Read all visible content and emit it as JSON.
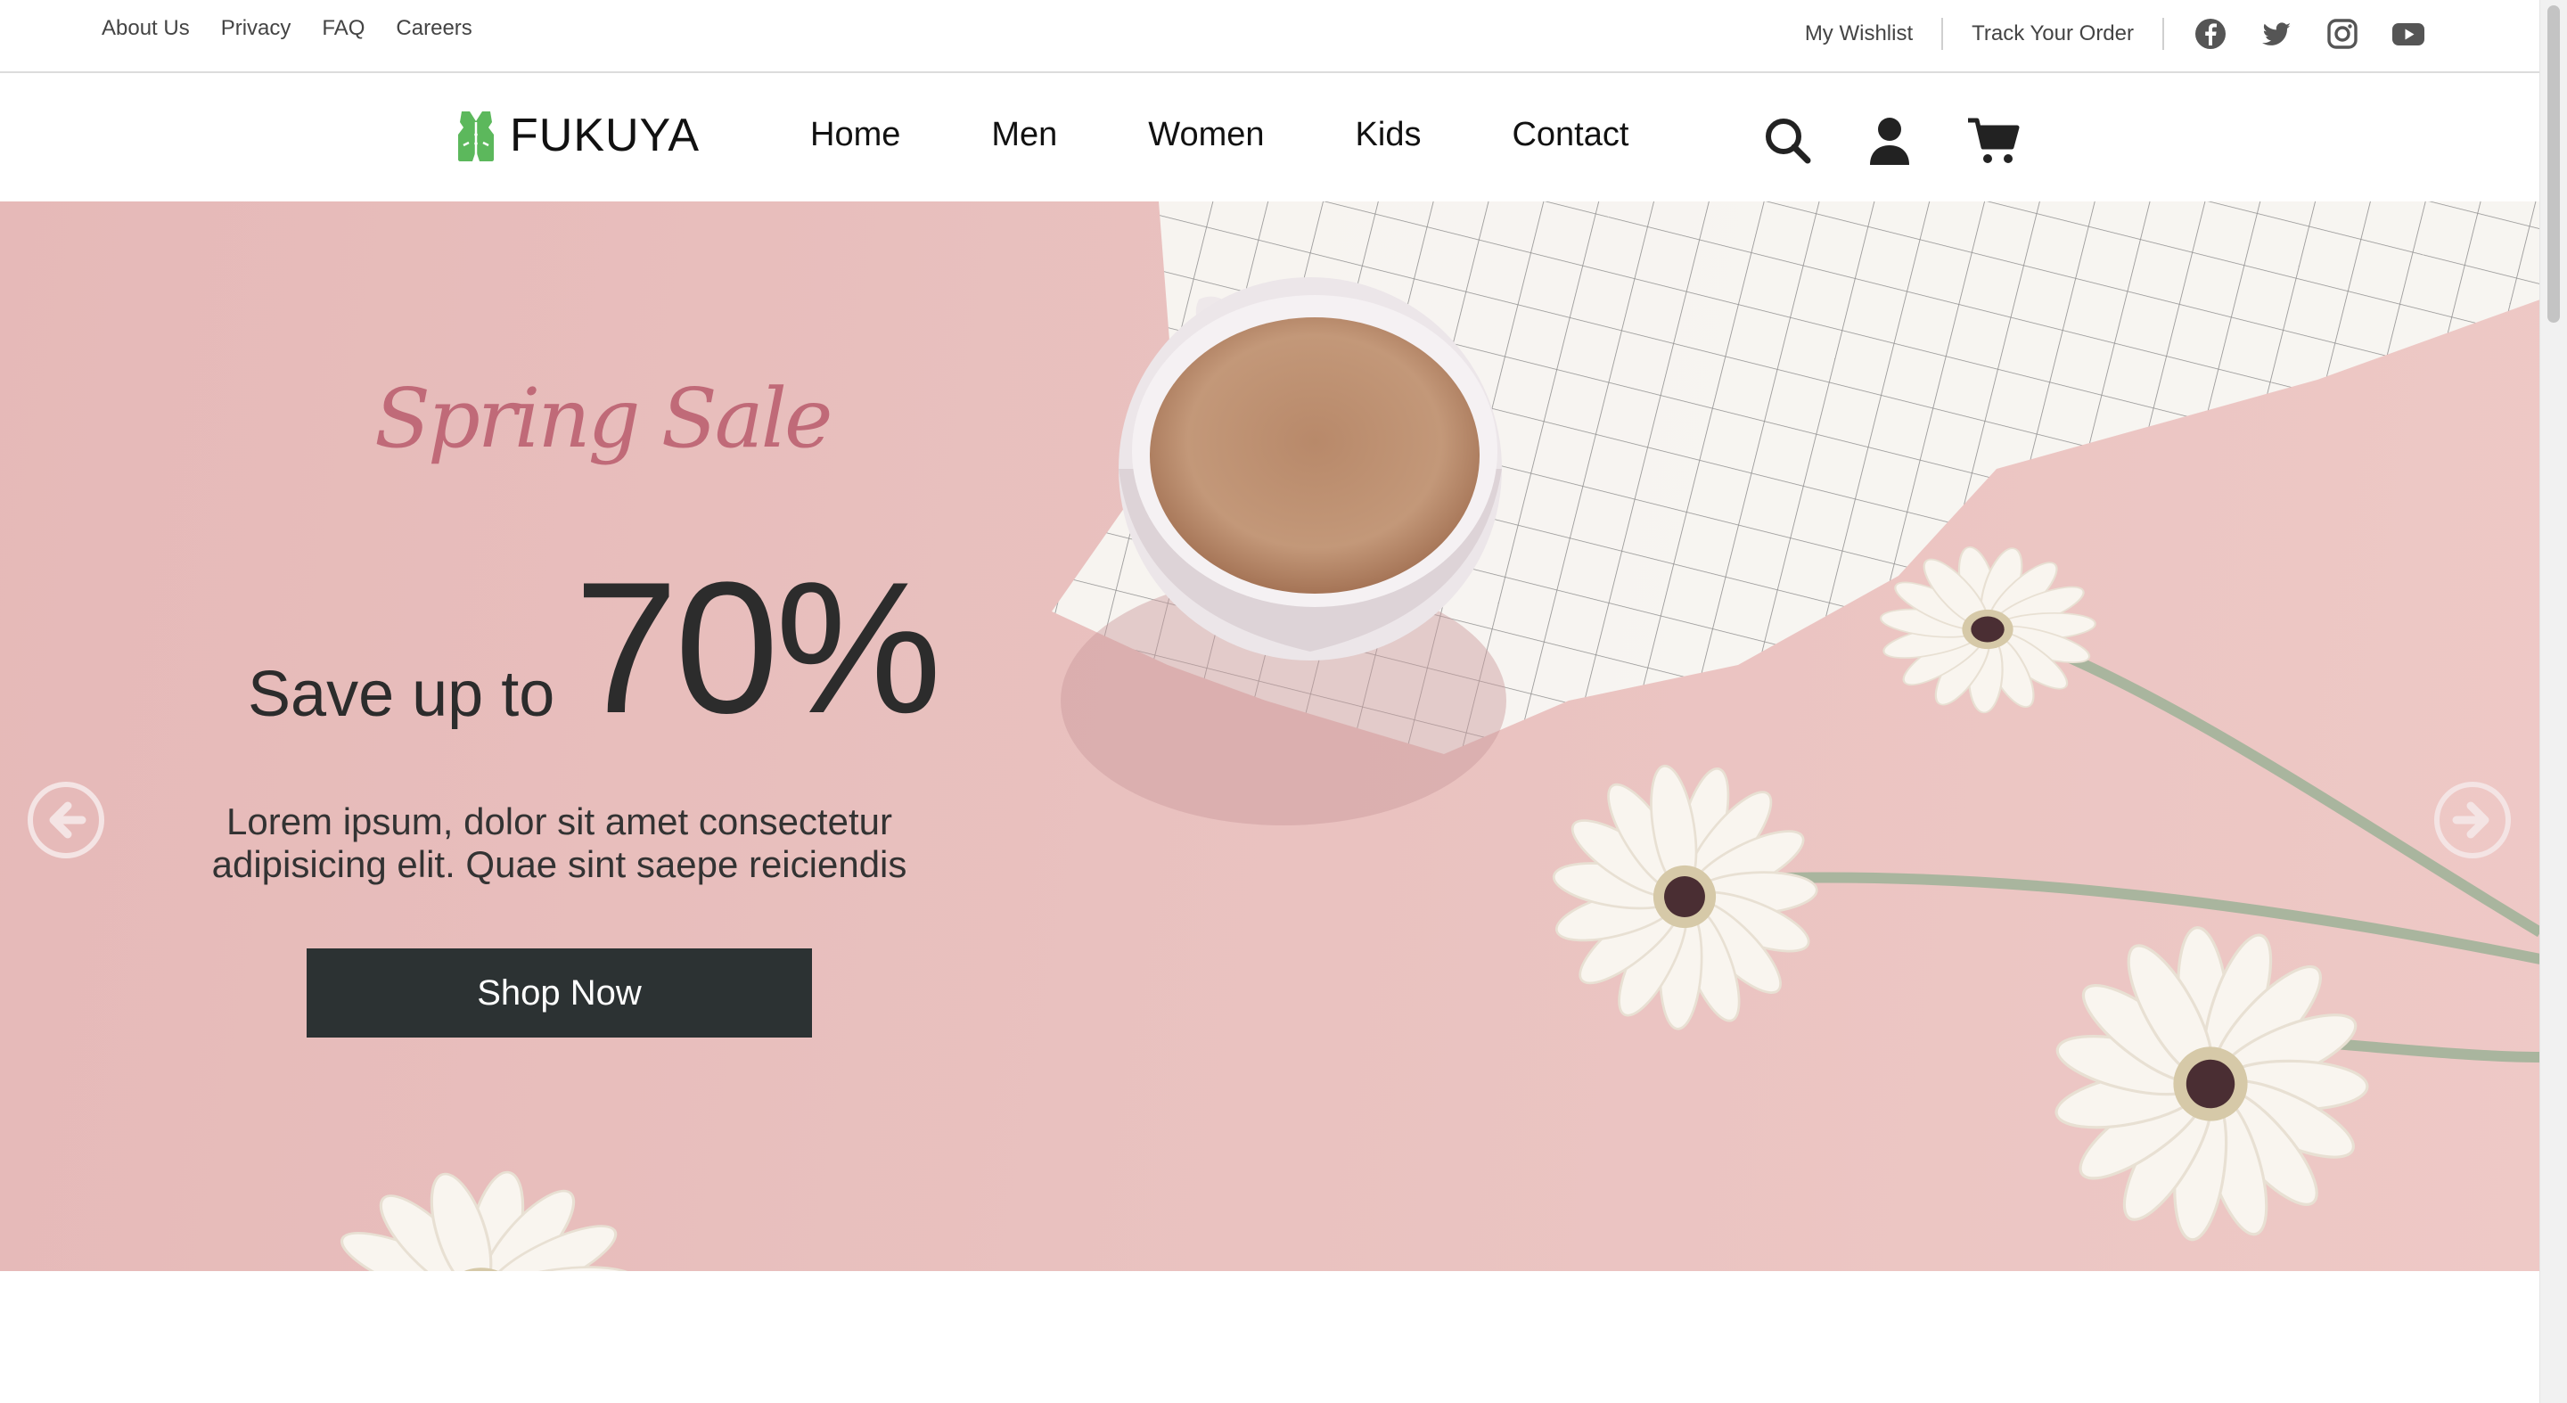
{
  "topbar": {
    "links": [
      "About Us",
      "Privacy",
      "FAQ",
      "Careers"
    ],
    "wishlist": "My Wishlist",
    "track_order": "Track Your Order",
    "social_icons": [
      "facebook-icon",
      "twitter-icon",
      "instagram-icon",
      "youtube-icon"
    ]
  },
  "brand": {
    "name": "FUKUYA",
    "logo_color": "#5cb85c"
  },
  "nav": {
    "items": [
      "Home",
      "Men",
      "Women",
      "Kids",
      "Contact"
    ],
    "icons": [
      "search-icon",
      "user-icon",
      "cart-icon"
    ]
  },
  "hero": {
    "script_title": "Spring Sale",
    "save_label": "Save up to",
    "save_percent": "70%",
    "body_text": "Lorem ipsum, dolor sit amet consectetur adipisicing elit. Quae sint saepe reiciendis",
    "cta": "Shop Now",
    "background_color": "#e8bdbc",
    "title_color": "#c06a78",
    "cta_color": "#2c3233"
  }
}
